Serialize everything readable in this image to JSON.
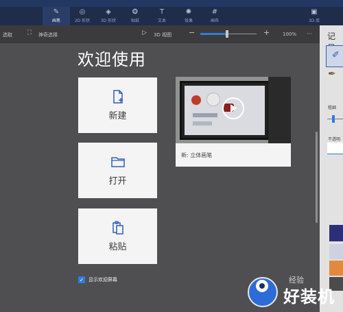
{
  "ribbon": {
    "tabs": [
      {
        "label": "画笔",
        "icon": "brush-icon"
      },
      {
        "label": "2D 形状",
        "icon": "2d-shapes-icon"
      },
      {
        "label": "3D 形状",
        "icon": "3d-shapes-icon"
      },
      {
        "label": "贴纸",
        "icon": "stickers-icon"
      },
      {
        "label": "文本",
        "icon": "text-icon"
      },
      {
        "label": "效果",
        "icon": "effects-icon"
      },
      {
        "label": "画布",
        "icon": "canvas-icon"
      },
      {
        "label": "3D 库",
        "icon": "3d-library-icon"
      }
    ],
    "active_tab_index": 0
  },
  "toolbar": {
    "left_label": "选取",
    "magic_select": "神奇选择",
    "view_3d": "3D 视图",
    "zoom_out": "−",
    "zoom_in": "+",
    "zoom_level": "100%",
    "more": "···",
    "zoom_fraction": 0.47
  },
  "right_panel": {
    "title": "记号",
    "thickness_label": "粗细",
    "opacity_label": "不透明",
    "swatches": [
      "#2b2f7a",
      "#cfd1de",
      "#e1893f",
      "#4b4b4b"
    ]
  },
  "welcome": {
    "title": "欢迎使用",
    "new_label": "新建",
    "open_label": "打开",
    "paste_label": "粘贴",
    "video_caption": "新: 立体画笔",
    "show_welcome_label": "显示欢迎屏幕",
    "show_welcome_checked": true
  },
  "watermark": {
    "text": "好装机",
    "small_text": "经验"
  },
  "colors": {
    "accent": "#2f7be0",
    "ribbon": "#1f2c4a",
    "canvas": "#4f4f52"
  }
}
